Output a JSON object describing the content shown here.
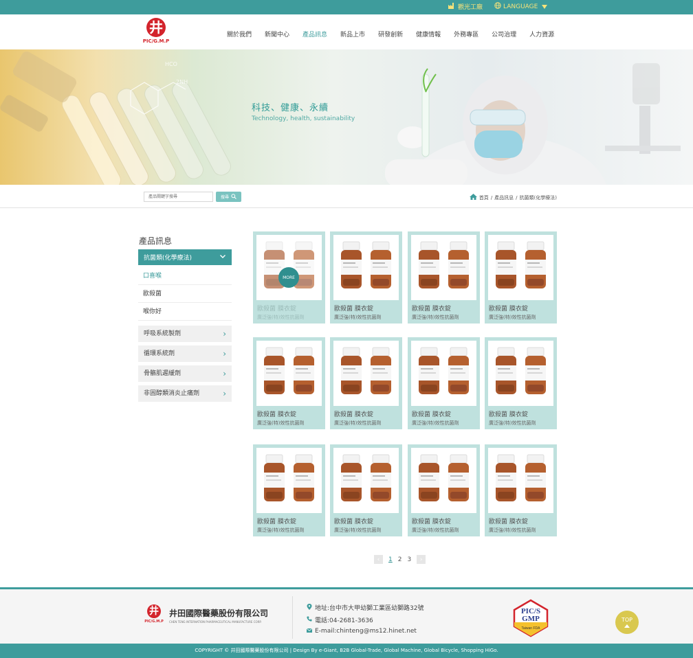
{
  "topbar": {
    "factory_link": "觀光工廠",
    "language_label": "LANGUAGE"
  },
  "brand": {
    "logo_mark": "井",
    "logo_text": "PIC/G.M.P"
  },
  "nav": {
    "items": [
      {
        "label": "關於我們"
      },
      {
        "label": "新聞中心"
      },
      {
        "label": "產品訊息"
      },
      {
        "label": "新品上市"
      },
      {
        "label": "研發創新"
      },
      {
        "label": "健康情報"
      },
      {
        "label": "外務專區"
      },
      {
        "label": "公司治理"
      },
      {
        "label": "人力資源"
      }
    ]
  },
  "banner": {
    "title": "科技、健康、永續",
    "subtitle": "Technology, health, sustainability"
  },
  "search": {
    "placeholder": "產品關鍵字搜尋",
    "button_label": "搜尋"
  },
  "breadcrumb": {
    "home": "首頁",
    "level1": "產品訊息",
    "level2": "抗菌類(化學療法)"
  },
  "sidebar": {
    "title": "產品訊息",
    "active_category": "抗菌類(化學療法)",
    "sub_items": [
      {
        "label": "口喜喉"
      },
      {
        "label": "歐殺菌"
      },
      {
        "label": "喉你好"
      }
    ],
    "categories": [
      {
        "label": "呼吸系統製劑"
      },
      {
        "label": "循環系統劑"
      },
      {
        "label": "骨骼肌遲緩劑"
      },
      {
        "label": "非固醇類消炎止痛劑"
      }
    ]
  },
  "products": {
    "more_label": "MORE",
    "items": [
      {
        "name": "歐殺菌 膜衣錠",
        "desc": "廣泛強(特)效性抗菌劑"
      },
      {
        "name": "歐殺菌 膜衣錠",
        "desc": "廣泛強(特)效性抗菌劑"
      },
      {
        "name": "歐殺菌 膜衣錠",
        "desc": "廣泛強(特)效性抗菌劑"
      },
      {
        "name": "歐殺菌 膜衣錠",
        "desc": "廣泛強(特)效性抗菌劑"
      },
      {
        "name": "歐殺菌 膜衣錠",
        "desc": "廣泛強(特)效性抗菌劑"
      },
      {
        "name": "歐殺菌 膜衣錠",
        "desc": "廣泛強(特)效性抗菌劑"
      },
      {
        "name": "歐殺菌 膜衣錠",
        "desc": "廣泛強(特)效性抗菌劑"
      },
      {
        "name": "歐殺菌 膜衣錠",
        "desc": "廣泛強(特)效性抗菌劑"
      },
      {
        "name": "歐殺菌 膜衣錠",
        "desc": "廣泛強(特)效性抗菌劑"
      },
      {
        "name": "歐殺菌 膜衣錠",
        "desc": "廣泛強(特)效性抗菌劑"
      },
      {
        "name": "歐殺菌 膜衣錠",
        "desc": "廣泛強(特)效性抗菌劑"
      },
      {
        "name": "歐殺菌 膜衣錠",
        "desc": "廣泛強(特)效性抗菌劑"
      }
    ]
  },
  "pagination": {
    "pages": [
      "1",
      "2",
      "3"
    ],
    "current": "1"
  },
  "footer": {
    "company_name": "井田國際醫藥股份有限公司",
    "company_name_en": "CHEN TENG INTERNATION PHARMACEUTICAL MANUFACTURE CORP.",
    "address": "地址:台中市大甲幼獅工業區幼獅路32號",
    "phone": "電話:04-2681-3636",
    "email": "E-mail:chinteng@ms12.hinet.net",
    "cert_line1": "PIC/S",
    "cert_line2": "GMP",
    "cert_line3": "Taiwan FDA",
    "top_label": "TOP",
    "copyright": "COPYRIGHT © 井田國際醫藥股份有限公司 | Design By e-Giant, B2B Global-Trade, Global Machine, Global Bicycle, Shopping HiGo."
  },
  "colors": {
    "teal": "#3e9c9c",
    "card_bg": "#bfe1de",
    "brand_red": "#d3242c",
    "top_button": "#d9c84f"
  }
}
